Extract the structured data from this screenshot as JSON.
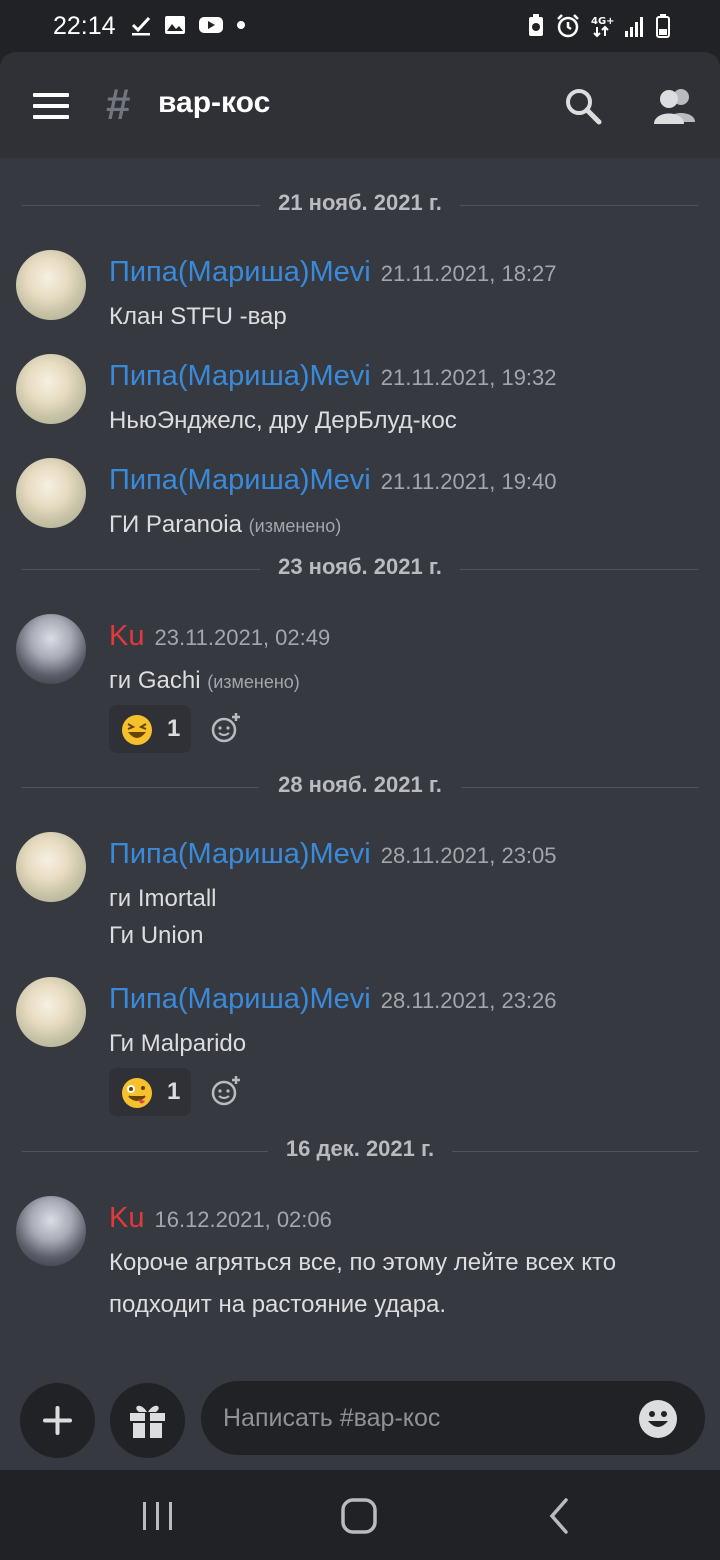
{
  "status_bar": {
    "time": "22:14"
  },
  "header": {
    "hash_symbol": "#",
    "channel_name": "вар-кос"
  },
  "date_separators": [
    "21 нояб. 2021 г.",
    "23 нояб. 2021 г.",
    "28 нояб. 2021 г.",
    "16 дек. 2021 г."
  ],
  "messages": [
    {
      "author": "Пипа(Мариша)Mevi",
      "timestamp": "21.11.2021, 18:27",
      "lines": [
        "Клан STFU -вар"
      ]
    },
    {
      "author": "Пипа(Мариша)Mevi",
      "timestamp": "21.11.2021, 19:32",
      "lines": [
        "НьюЭнджелс, дру ДерБлуд-кос"
      ]
    },
    {
      "author": "Пипа(Мариша)Mevi",
      "timestamp": "21.11.2021, 19:40",
      "lines": [
        "ГИ Paranoia"
      ],
      "edited": "(изменено)"
    },
    {
      "author": "Ku",
      "timestamp": "23.11.2021, 02:49",
      "lines": [
        "ги Gachi"
      ],
      "edited": "(изменено)",
      "reaction": {
        "emoji": "laughing-face",
        "count": "1"
      }
    },
    {
      "author": "Пипа(Мариша)Mevi",
      "timestamp": "28.11.2021, 23:05",
      "lines": [
        "ги Imortall",
        "Ги Union"
      ]
    },
    {
      "author": "Пипа(Мариша)Mevi",
      "timestamp": "28.11.2021, 23:26",
      "lines": [
        "Ги Malparido"
      ],
      "reaction": {
        "emoji": "zany-face",
        "count": "1"
      }
    },
    {
      "author": "Ku",
      "timestamp": "16.12.2021, 02:06",
      "lines": [
        "Короче агряться все, по этому лейте всех кто",
        "подходит на растояние удара."
      ]
    }
  ],
  "composer": {
    "placeholder": "Написать #вар-кос"
  },
  "colors": {
    "background": "#36393f",
    "header": "#2f3136",
    "author_mevi": "#3b8ad9",
    "author_ku": "#e03a3a"
  }
}
